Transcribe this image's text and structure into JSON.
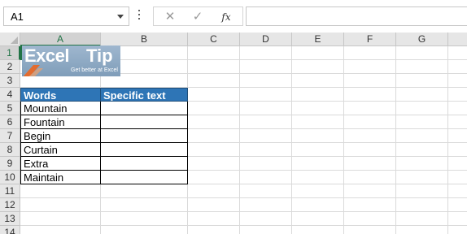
{
  "formula_bar": {
    "name_box": "A1",
    "cancel_icon": "✕",
    "enter_icon": "✓",
    "fx_label": "fx",
    "formula": ""
  },
  "columns": [
    "A",
    "B",
    "C",
    "D",
    "E",
    "F",
    "G"
  ],
  "rows": [
    "1",
    "2",
    "3",
    "4",
    "5",
    "6",
    "7",
    "8",
    "9",
    "10",
    "11",
    "12",
    "13",
    "14"
  ],
  "logo": {
    "word1": "Excel",
    "word2": "Tip",
    "tagline": "Get better at Excel"
  },
  "table": {
    "headers": [
      "Words",
      "Specific text"
    ],
    "words": [
      "Mountain",
      "Fountain",
      "Begin",
      "Curtain",
      "Extra",
      "Maintain"
    ],
    "specific": [
      "",
      "",
      "",
      "",
      "",
      ""
    ]
  },
  "colors": {
    "header_fill": "#2e75b6",
    "selection": "#217346",
    "logo_bg": "#8faac4",
    "logo_accent": "#e36c2f"
  }
}
